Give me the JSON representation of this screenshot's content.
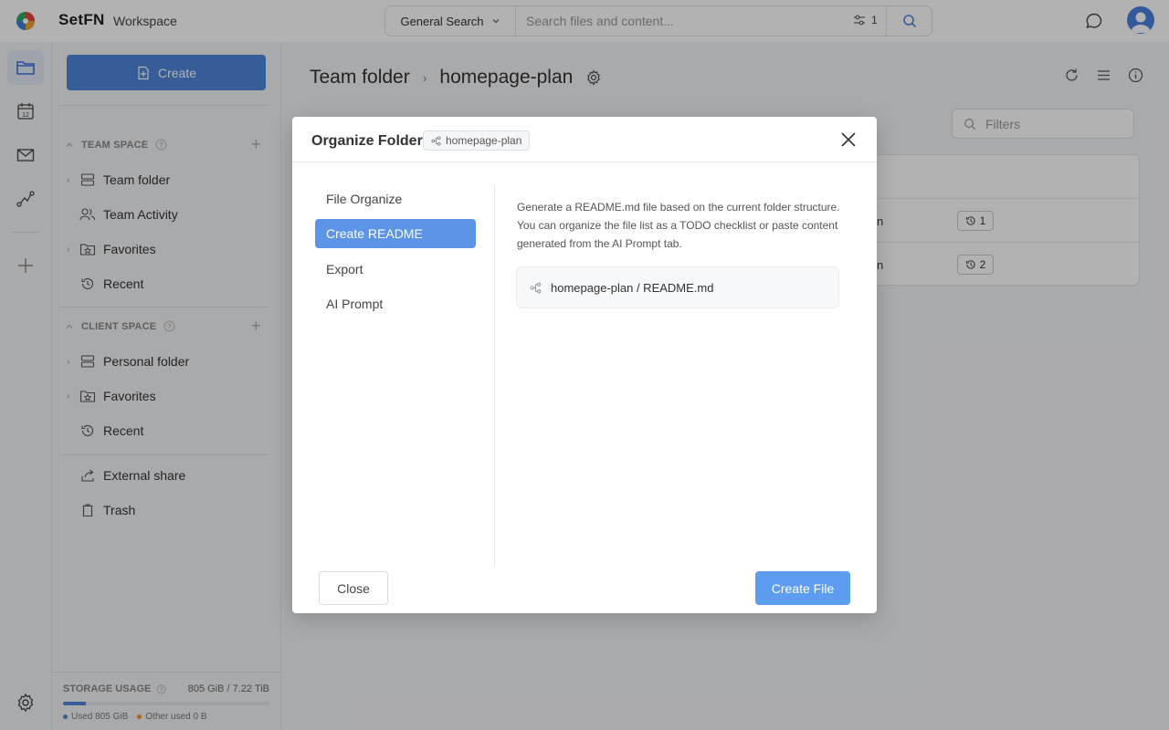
{
  "app": {
    "brand": "SetFN",
    "workspace": "Workspace"
  },
  "search": {
    "type_label": "General Search",
    "placeholder": "Search files and content...",
    "filter_count": "1"
  },
  "sidebar": {
    "create_label": "Create",
    "team_space": {
      "title": "TEAM SPACE",
      "items": [
        {
          "label": "Team folder",
          "icon": "server-icon"
        },
        {
          "label": "Team Activity",
          "icon": "people-icon"
        },
        {
          "label": "Favorites",
          "icon": "star-folder-icon"
        },
        {
          "label": "Recent",
          "icon": "history-icon"
        }
      ]
    },
    "client_space": {
      "title": "CLIENT SPACE",
      "items": [
        {
          "label": "Personal folder",
          "icon": "server-icon"
        },
        {
          "label": "Favorites",
          "icon": "star-folder-icon"
        },
        {
          "label": "Recent",
          "icon": "history-icon"
        }
      ]
    },
    "extra": [
      {
        "label": "External share",
        "icon": "share-icon"
      },
      {
        "label": "Trash",
        "icon": "trash-icon"
      }
    ],
    "storage": {
      "title": "STORAGE USAGE",
      "amount": "805 GiB / 7.22 TiB",
      "used_fraction": 0.109,
      "used_label": "Used 805 GiB",
      "other_label": "Other used 0 B",
      "used_color": "#4f86db",
      "other_color": "#f0922e"
    }
  },
  "main": {
    "breadcrumb": {
      "root": "Team folder",
      "current": "homepage-plan"
    },
    "filters_placeholder": "Filters",
    "rows": [
      {
        "text_fragment": "n",
        "version": "1"
      },
      {
        "text_fragment": "n",
        "version": "2"
      }
    ]
  },
  "modal": {
    "title": "Organize Folder",
    "tag": "homepage-plan",
    "menu": [
      "File Organize",
      "Create README",
      "Export",
      "AI Prompt"
    ],
    "active_menu": "Create README",
    "description": "Generate a README.md file based on the current folder structure. You can organize the file list as a TODO checklist or paste content generated from the AI Prompt tab.",
    "file_path": "homepage-plan / README.md",
    "close_label": "Close",
    "create_label": "Create File"
  },
  "colors": {
    "accent": "#4f86db",
    "active_menu": "#5c95e8",
    "primary_button": "#5c9df0"
  }
}
